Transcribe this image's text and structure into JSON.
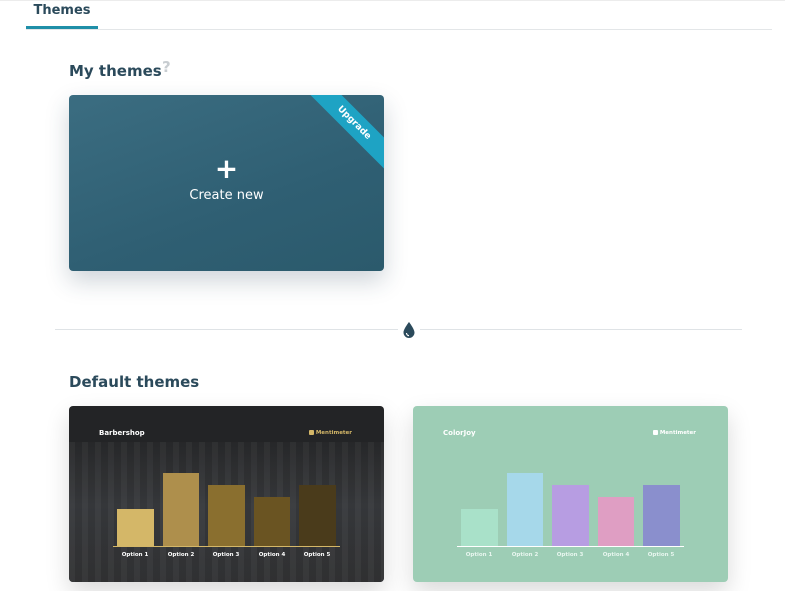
{
  "tabs": [
    {
      "label": "Themes",
      "active": true
    }
  ],
  "my_themes": {
    "title": "My themes",
    "help_icon": "?",
    "create_card": {
      "plus": "+",
      "label": "Create new",
      "ribbon": "Upgrade"
    }
  },
  "divider_icon": "drop-icon",
  "default_themes": {
    "title": "Default themes",
    "themes": [
      {
        "name": "Barbershop",
        "brand": "Mentimeter",
        "colors": {
          "background": "#232426",
          "bars": [
            "#d4b768",
            "#ae8f4c",
            "#8a6f2f",
            "#6a5422",
            "#4a3b1b"
          ],
          "text": "#ffffff",
          "brand": "#d4b768"
        },
        "options": [
          "Option 1",
          "Option 2",
          "Option 3",
          "Option 4",
          "Option 5"
        ],
        "values": [
          37,
          73,
          61,
          49,
          61
        ]
      },
      {
        "name": "ColorJoy",
        "brand": "Mentimeter",
        "colors": {
          "background": "#9dcdb5",
          "bars": [
            "#a9e1c9",
            "#a6d8ea",
            "#b79de2",
            "#df9ec3",
            "#8a8fcd"
          ],
          "text": "#ffffff",
          "brand": "#ffffff"
        },
        "options": [
          "Option 1",
          "Option 2",
          "Option 3",
          "Option 4",
          "Option 5"
        ],
        "values": [
          37,
          73,
          61,
          49,
          61
        ]
      }
    ]
  }
}
